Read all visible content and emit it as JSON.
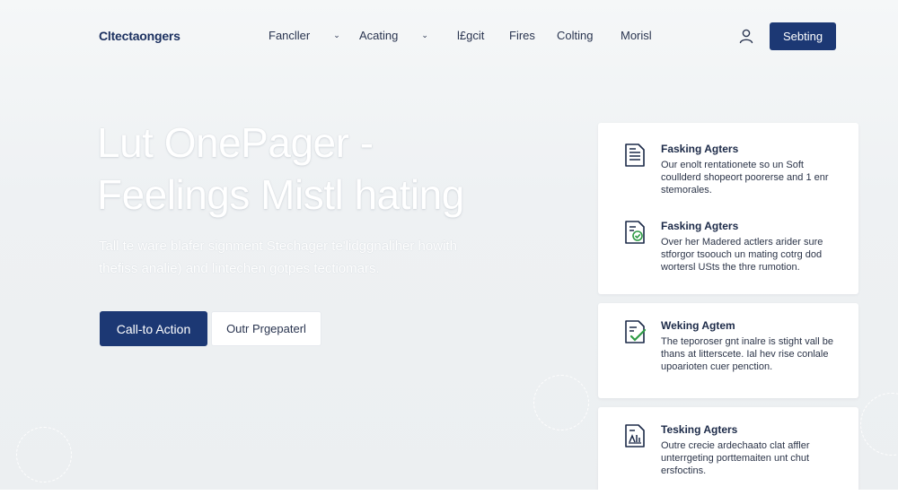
{
  "nav": {
    "brand": "Cltectaongers",
    "items": [
      {
        "label": "Fancller",
        "has_dropdown": true
      },
      {
        "label": "Acating",
        "has_dropdown": true
      },
      {
        "label": "l£gcit",
        "has_dropdown": false
      },
      {
        "label": "Fires",
        "has_dropdown": false
      },
      {
        "label": "Colting",
        "has_dropdown": false
      },
      {
        "label": "Morisl",
        "has_dropdown": false
      }
    ],
    "user_icon": "user-icon",
    "cta_label": "Sebting",
    "accent_color": "#1c3874"
  },
  "hero": {
    "title_line1": "Lut OnePager -",
    "title_line2": "Feelings Mistl hating",
    "subtitle_line1": "Tall te ware blafer signment Stechager te'lidggnaliher howith",
    "subtitle_line2": "thefiss analie) and lintechen gotpes tectiomars.",
    "primary_button": "Call-to Action",
    "secondary_button": "Outr Prgepaterl"
  },
  "cards": [
    {
      "features": [
        {
          "icon": "document-list-icon",
          "title": "Fasking Agters",
          "description": "Our enolt rentationete so un Soft coullderd shopeort poorerse and 1 enr stemorales."
        },
        {
          "icon": "document-check-circle-icon",
          "title": "Fasking Agters",
          "description": "Over her Madered actlers arider sure stforgor tsoouch un mating cotrg dod wortersl USts the thre rumotion."
        }
      ]
    },
    {
      "features": [
        {
          "icon": "document-checkmark-icon",
          "title": "Weking Agtem",
          "description": "The teporoser gnt inalre is stight vall be thans at litterscete. Ial hev rise conlale upoarioten cuer penction."
        }
      ]
    },
    {
      "features": [
        {
          "icon": "document-chart-icon",
          "title": "Tesking Agters",
          "description": "Outre crecie ardechaato clat affler unterrgeting porttemaiten unt chut ersfoctins."
        }
      ]
    }
  ]
}
